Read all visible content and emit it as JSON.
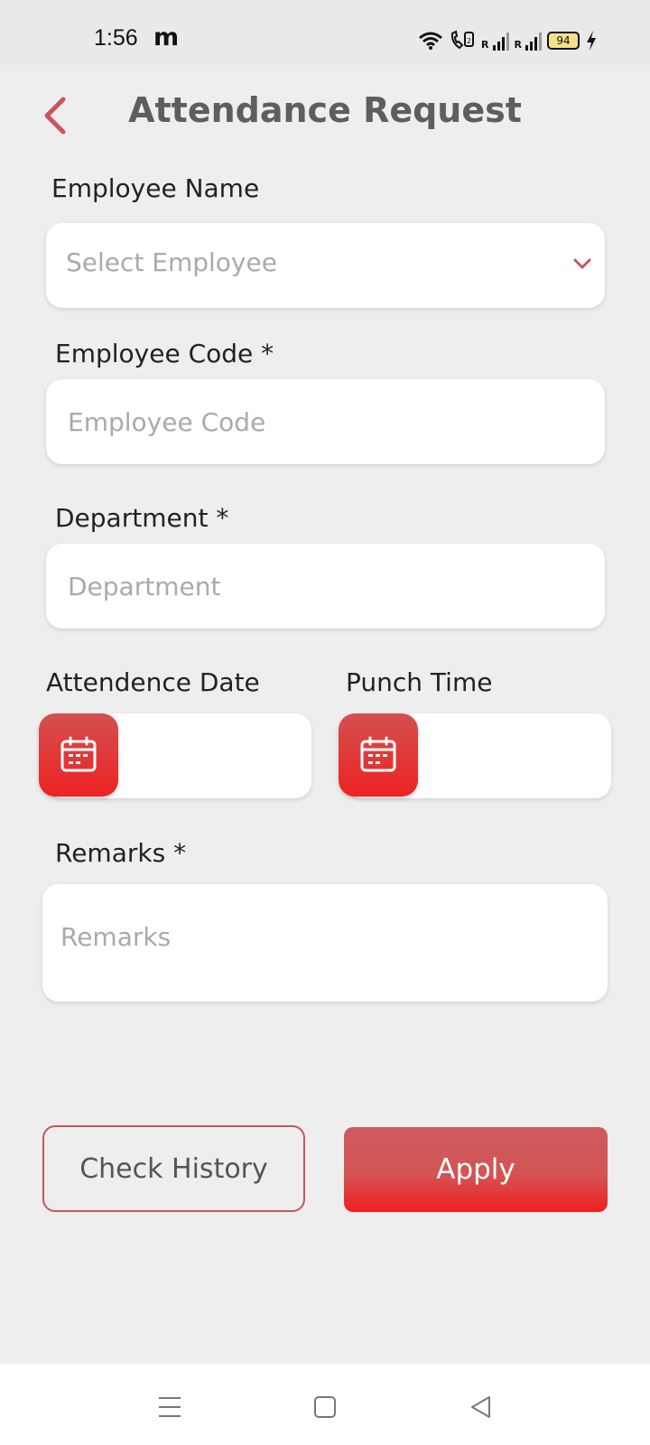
{
  "status_bar": {
    "time": "1:56",
    "app_icon": "m",
    "battery": "94",
    "icons": [
      "wifi-icon",
      "volte-call-icon",
      "signal-icon",
      "signal-icon",
      "battery-icon",
      "charging-icon"
    ],
    "signal_labels": [
      "R",
      "R"
    ]
  },
  "header": {
    "title": "Attendance Request",
    "back_icon": "chevron-left-icon"
  },
  "form": {
    "employee_name": {
      "label": "Employee Name",
      "placeholder": "Select Employee",
      "icon": "chevron-down-icon"
    },
    "employee_code": {
      "label": "Employee Code *",
      "placeholder": "Employee Code",
      "value": ""
    },
    "department": {
      "label": "Department *",
      "placeholder": "Department",
      "value": ""
    },
    "attendance_date": {
      "label": "Attendence Date",
      "value": "",
      "icon": "calendar-icon"
    },
    "punch_time": {
      "label": "Punch Time",
      "value": "",
      "icon": "calendar-icon"
    },
    "remarks": {
      "label": "Remarks *",
      "placeholder": "Remarks",
      "value": ""
    }
  },
  "actions": {
    "check_history": "Check History",
    "apply": "Apply"
  },
  "nav_bar": {
    "icons": [
      "menu-icon",
      "home-icon",
      "back-icon"
    ]
  },
  "colors": {
    "accent": "#c9555b",
    "accent_bright": "#f01f1f",
    "background": "#eeeeee",
    "title": "#5e5e5e",
    "placeholder": "#aaaaaa"
  }
}
